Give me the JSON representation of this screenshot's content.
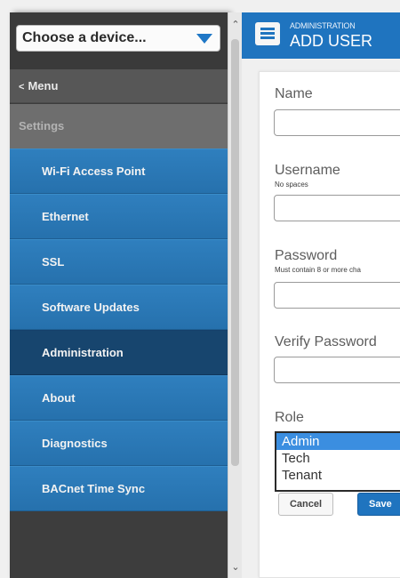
{
  "device_selector": {
    "value": "Choose a device..."
  },
  "sidebar": {
    "back_label": "Menu",
    "section_header": "Settings",
    "items": [
      {
        "label": "Wi-Fi Access Point",
        "active": false
      },
      {
        "label": "Ethernet",
        "active": false
      },
      {
        "label": "SSL",
        "active": false
      },
      {
        "label": "Software Updates",
        "active": false
      },
      {
        "label": "Administration",
        "active": true
      },
      {
        "label": "About",
        "active": false
      },
      {
        "label": "Diagnostics",
        "active": false
      },
      {
        "label": "BACnet Time Sync",
        "active": false
      }
    ]
  },
  "header": {
    "breadcrumb": "ADMINISTRATION",
    "title": "ADD USER"
  },
  "form": {
    "name_label": "Name",
    "username_label": "Username",
    "username_hint": "No spaces",
    "password_label": "Password",
    "password_hint": "Must contain 8 or more cha",
    "verify_label": "Verify Password",
    "role_label": "Role",
    "role_options": [
      "Admin",
      "Tech",
      "Tenant"
    ],
    "role_selected": "Admin",
    "cancel_label": "Cancel",
    "save_label": "Save"
  },
  "colors": {
    "accent": "#1f74bf",
    "nav_item": "#2b78b7",
    "nav_active": "#17456e",
    "sidebar_bg": "#3d3d3d"
  }
}
